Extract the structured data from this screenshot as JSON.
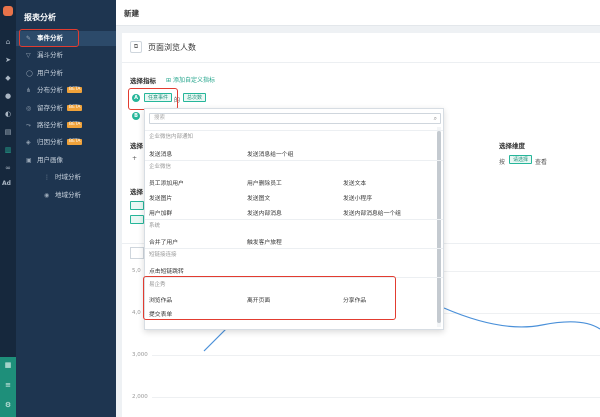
{
  "sidebar": {
    "title": "报表分析",
    "items": [
      {
        "label": "事件分析",
        "icon": "edit-icon",
        "active": true
      },
      {
        "label": "漏斗分析",
        "icon": "funnel-icon"
      },
      {
        "label": "用户分析",
        "icon": "user-icon"
      },
      {
        "label": "分布分析",
        "icon": "distribution-icon",
        "badge": "BETA"
      },
      {
        "label": "留存分析",
        "icon": "retention-icon",
        "badge": "BETA"
      },
      {
        "label": "路径分析",
        "icon": "path-icon",
        "badge": "BETA"
      },
      {
        "label": "归因分析",
        "icon": "attribution-icon",
        "badge": "BETA"
      },
      {
        "label": "用户画像",
        "icon": "portrait-icon"
      },
      {
        "label": "时域分析",
        "icon": "time-icon",
        "sub": true
      },
      {
        "label": "地域分析",
        "icon": "region-icon",
        "sub": true
      }
    ]
  },
  "rail": {
    "ad_label": "Ad"
  },
  "header": {
    "breadcrumb": "新建"
  },
  "report": {
    "name": "页面浏览人数",
    "select_metric_label": "选择指标",
    "add_custom_metric": "添加自定义指标",
    "metric_a_letter": "A",
    "metric_b_letter": "B",
    "any_event_tag": "任意事件",
    "of_text": "的",
    "total_count_tag": "总次数",
    "select_dimension_label": "选择维度",
    "by_text": "按",
    "select_tag": "请选择",
    "view_text": "查看",
    "partial_label_1": "选择",
    "partial_label_2": "选择",
    "partial_plus": "+"
  },
  "chart": {
    "y_ticks": [
      "5,0",
      "4,0",
      "3,000",
      "2,000"
    ]
  },
  "dropdown": {
    "search_placeholder": "搜索",
    "groups": [
      {
        "title": "企业微信内部通知",
        "items": [
          "发送消息",
          "发送消息给一个组"
        ]
      },
      {
        "title": "企业微信",
        "items": [
          "员工添加用户",
          "用户删除员工",
          "发送文本",
          "发送图片",
          "发送图文",
          "发送小程序",
          "用户加群",
          "发送内部消息",
          "发送内部消息给一个组"
        ]
      },
      {
        "title": "系统",
        "items": [
          "合并了用户",
          "触发客户旅程"
        ]
      },
      {
        "title": "短链接连接",
        "items": [
          "点击短链跳转"
        ]
      },
      {
        "title": "易企秀",
        "items": [
          "浏览作品",
          "离开页面",
          "分享作品",
          "提交表单"
        ]
      }
    ]
  },
  "colors": {
    "accent": "#26b69a",
    "highlight": "#e23c30",
    "sidebar": "#1e3550"
  }
}
